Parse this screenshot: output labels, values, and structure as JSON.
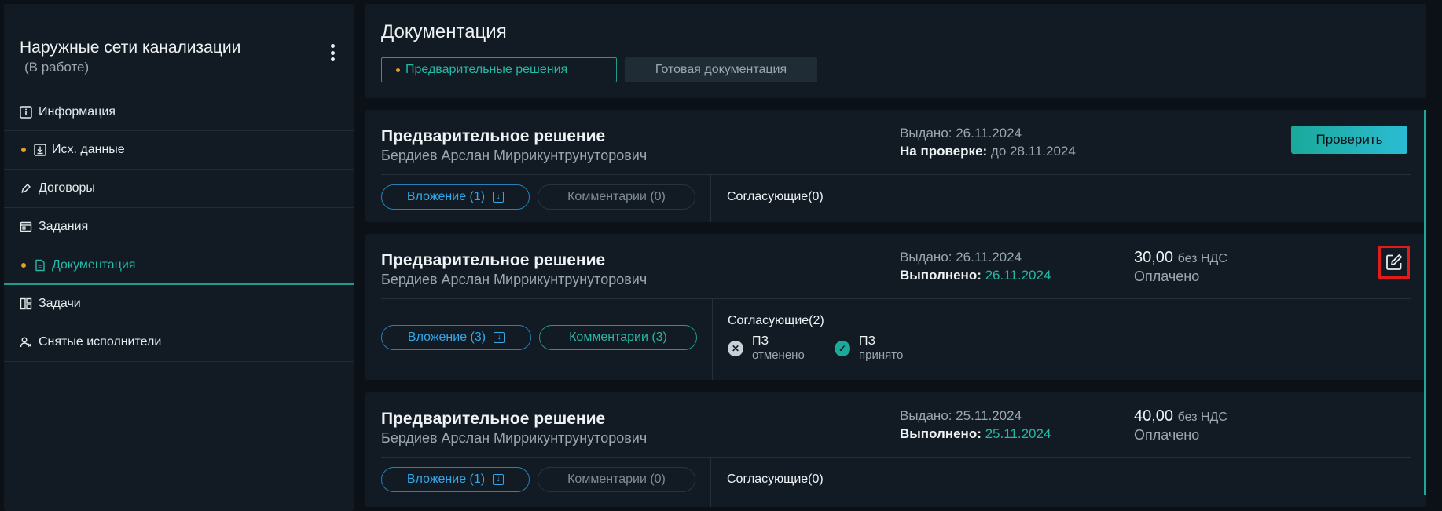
{
  "sidebar": {
    "title": "Наружные сети канализации",
    "status": "(В работе)",
    "items": [
      {
        "label": "Информация",
        "icon": "info-icon"
      },
      {
        "label": "Исх. данные",
        "icon": "download-icon"
      },
      {
        "label": "Договоры",
        "icon": "pen-icon"
      },
      {
        "label": "Задания",
        "icon": "tasks-icon"
      },
      {
        "label": "Документация",
        "icon": "document-icon"
      },
      {
        "label": "Задачи",
        "icon": "board-icon"
      },
      {
        "label": "Снятые исполнители",
        "icon": "user-x-icon"
      }
    ]
  },
  "header": {
    "title": "Документация",
    "tabs": [
      {
        "label": "Предварительные решения"
      },
      {
        "label": "Готовая документация"
      }
    ]
  },
  "cards": [
    {
      "title": "Предварительное решение",
      "author": "Бердиев Арслан Миррикунтрунуторович",
      "issued": "Выдано: 26.11.2024",
      "state_label": "На проверке:",
      "state_value": "до 28.11.2024",
      "action_label": "Проверить",
      "attachment": "Вложение (1)",
      "comments": "Комментарии (0)",
      "approvers": "Согласующие(0)"
    },
    {
      "title": "Предварительное решение",
      "author": "Бердиев Арслан Миррикунтрунуторович",
      "issued": "Выдано: 26.11.2024",
      "state_label": "Выполнено:",
      "state_value": "26.11.2024",
      "price": "30,00",
      "price_suffix": "без НДС",
      "paid": "Оплачено",
      "attachment": "Вложение (3)",
      "comments": "Комментарии (3)",
      "approvers": "Согласующие(2)",
      "approver_list": [
        {
          "name": "ПЗ",
          "status": "отменено"
        },
        {
          "name": "ПЗ",
          "status": "принято"
        }
      ]
    },
    {
      "title": "Предварительное решение",
      "author": "Бердиев Арслан Миррикунтрунуторович",
      "issued": "Выдано: 25.11.2024",
      "state_label": "Выполнено:",
      "state_value": "25.11.2024",
      "price": "40,00",
      "price_suffix": "без НДС",
      "paid": "Оплачено",
      "attachment": "Вложение (1)",
      "comments": "Комментарии (0)",
      "approvers": "Согласующие(0)"
    }
  ],
  "colors": {
    "accent": "#24b8a6",
    "attachment": "#35a6e8",
    "indicator": "#e0a12a",
    "highlight": "#e01b1b"
  }
}
